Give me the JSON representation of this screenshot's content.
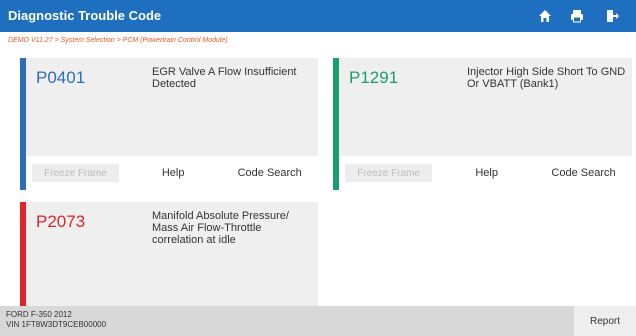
{
  "header": {
    "title": "Diagnostic Trouble Code",
    "icons": [
      "home-icon",
      "print-icon",
      "exit-icon"
    ]
  },
  "breadcrumb": "DEMO V11.27 > System Selection > PCM (Powertrain Control Module)",
  "dtcs": [
    {
      "code": "P0401",
      "color": "#2f6cc0",
      "description": "EGR Valve A Flow Insufficient Detected",
      "buttons": [
        "Freeze Frame",
        "Help",
        "Code Search"
      ]
    },
    {
      "code": "P1291",
      "color": "#1a9e6e",
      "description": "Injector High Side Short To GND Or VBATT (Bank1)",
      "buttons": [
        "Freeze Frame",
        "Help",
        "Code Search"
      ]
    },
    {
      "code": "P2073",
      "color": "#e0242a",
      "description": "Manifold Absolute Pressure/ Mass Air Flow-Throttle correlation at idle"
    }
  ],
  "footer": {
    "vehicle": "FORD F-350 2012",
    "vin": "VIN 1FT8W3DT9CEB00000",
    "report_label": "Report"
  },
  "colors": {
    "header_bg": "#1f6fc0",
    "breadcrumb": "#e85a2a"
  }
}
